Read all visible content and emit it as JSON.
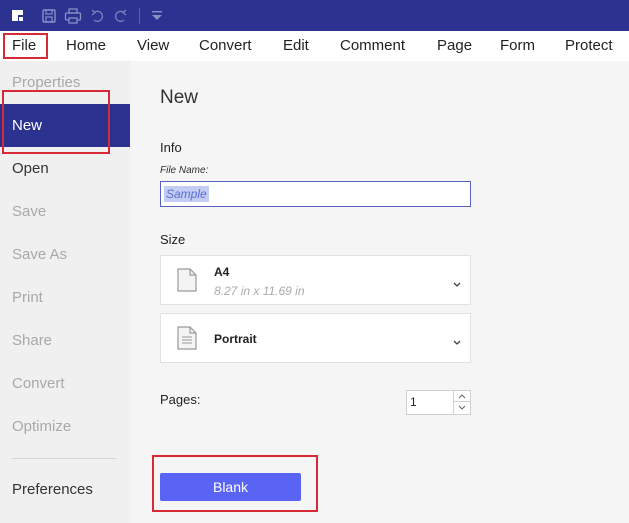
{
  "menu": {
    "items": [
      "File",
      "Home",
      "View",
      "Convert",
      "Edit",
      "Comment",
      "Page",
      "Form",
      "Protect"
    ]
  },
  "sidebar": {
    "items": [
      "Properties",
      "New",
      "Open",
      "Save",
      "Save As",
      "Print",
      "Share",
      "Convert",
      "Optimize",
      "Preferences"
    ],
    "active": "New"
  },
  "main": {
    "title": "New",
    "info_label": "Info",
    "file_name_label": "File Name:",
    "file_name_value": "Sample",
    "size_label": "Size",
    "paper_size": {
      "name": "A4",
      "dimensions": "8.27 in x 11.69 in"
    },
    "orientation": "Portrait",
    "pages_label": "Pages:",
    "pages_value": "1",
    "blank_button": "Blank"
  },
  "colors": {
    "titlebar": "#2b3290",
    "active_item": "#2b3290",
    "button": "#5a64f4",
    "highlight_outline": "#d62a36"
  },
  "icons": [
    "app-logo-icon",
    "save-icon",
    "print-icon",
    "undo-icon",
    "redo-icon",
    "customize-dropdown-icon",
    "document-icon",
    "document-lines-icon",
    "chevron-down-icon",
    "spinner-up-icon",
    "spinner-down-icon"
  ]
}
